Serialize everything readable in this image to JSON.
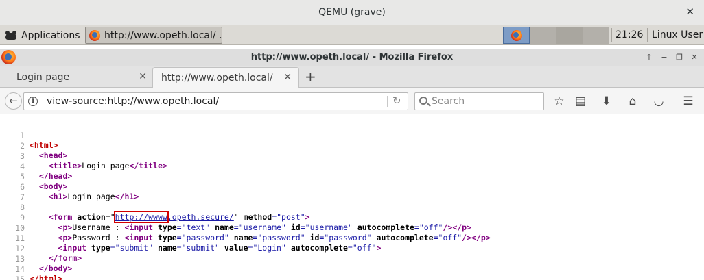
{
  "qemu": {
    "title": "QEMU (grave)",
    "close_glyph": "✕"
  },
  "panel": {
    "applications_label": "Applications",
    "task_label": "http://www.opeth.local/ ...",
    "clock": "21:26",
    "user": "Linux User"
  },
  "window": {
    "title": "http://www.opeth.local/ - Mozilla Firefox",
    "ctrl_up": "↑",
    "ctrl_min": "−",
    "ctrl_max": "❐",
    "ctrl_close": "✕"
  },
  "tabs": [
    {
      "label": "Login page",
      "close": "✕"
    },
    {
      "label": "http://www.opeth.local/",
      "close": "✕"
    }
  ],
  "new_tab_glyph": "+",
  "navbar": {
    "back_glyph": "←",
    "url": "view-source:http://www.opeth.local/",
    "reload_glyph": "↻",
    "search_placeholder": "Search",
    "info_glyph": "i",
    "icons": {
      "bookmark-star-icon": "☆",
      "reading-list-icon": "▤",
      "download-icon": "⬇",
      "home-icon": "⌂",
      "pocket-icon": "◡",
      "menu-icon": "☰"
    }
  },
  "source": {
    "line_numbers": [
      "1",
      "2",
      "3",
      "4",
      "5",
      "6",
      "7",
      "8",
      "9",
      "10",
      "11",
      "12",
      "13",
      "14",
      "15"
    ],
    "l1": {
      "tag": "<html>"
    },
    "l2": {
      "tag": "<head>"
    },
    "l3": {
      "open": "<title>",
      "text": "Login page",
      "close": "</title>"
    },
    "l4": {
      "tag": "</head>"
    },
    "l5": {
      "tag": "<body>"
    },
    "l6": {
      "open": "<h1>",
      "text": "Login page",
      "close": "</h1>"
    },
    "l8": {
      "open": "<form",
      "attr1": "action",
      "eq_q": "=\"",
      "link_highlight": "http://wwww",
      "link_rest": ".opeth.secure/",
      "q_sp": "\" ",
      "attr2": "method",
      "val2": "=\"post\"",
      "close": ">"
    },
    "l9": {
      "p_open": "<p>",
      "label": "Username : ",
      "input_open": "<input",
      "a1": " type",
      "v1": "=\"text\"",
      "a2": " name",
      "v2": "=\"username\"",
      "a3": " id",
      "v3": "=\"username\"",
      "a4": " autocomplete",
      "v4": "=\"off\"",
      "self_close": "/>",
      "p_close": "</p>"
    },
    "l10": {
      "p_open": "<p>",
      "label": "Password : ",
      "input_open": "<input",
      "a1": " type",
      "v1": "=\"password\"",
      "a2": " name",
      "v2": "=\"password\"",
      "a3": " id",
      "v3": "=\"password\"",
      "a4": " autocomplete",
      "v4": "=\"off\"",
      "self_close": "/>",
      "p_close": "</p>"
    },
    "l11": {
      "input_open": "<input",
      "a1": " type",
      "v1": "=\"submit\"",
      "a2": " name",
      "v2": "=\"submit\"",
      "a3": " value",
      "v3": "=\"Login\"",
      "a4": " autocomplete",
      "v4": "=\"off\"",
      "close": ">"
    },
    "l12": {
      "tag": "</form>"
    },
    "l13": {
      "tag": "</body>"
    },
    "l14": {
      "tag": "</html>"
    }
  }
}
